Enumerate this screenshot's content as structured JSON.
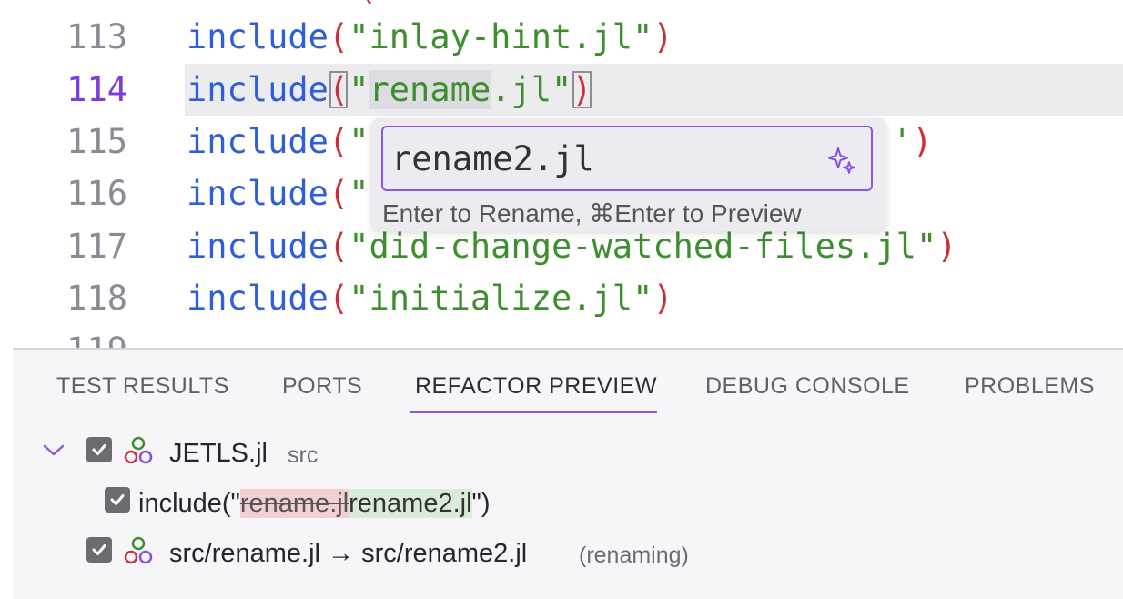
{
  "editor": {
    "lines": [
      {
        "num": "113",
        "kw": "include",
        "open": "(",
        "str": "\"inlay-hint.jl\"",
        "close": ")"
      },
      {
        "num": "114",
        "kw": "include",
        "open": "(",
        "q1": "\"",
        "sel": "rename",
        "rest": ".jl\"",
        "close": ")"
      },
      {
        "num": "115",
        "kw": "include",
        "open": "(",
        "frag": "\"",
        "tail": "')"
      },
      {
        "num": "116",
        "kw": "include",
        "open": "(",
        "frag": "\""
      },
      {
        "num": "117",
        "kw": "include",
        "open": "(",
        "str": "\"did-change-watched-files.jl\"",
        "close": ")"
      },
      {
        "num": "118",
        "kw": "include",
        "open": "(",
        "str": "\"initialize.jl\"",
        "close": ")"
      }
    ],
    "rename": {
      "value": "rename2.jl",
      "hint": "Enter to Rename, ⌘Enter to Preview"
    }
  },
  "panel": {
    "tabs": [
      "TEST RESULTS",
      "PORTS",
      "REFACTOR PREVIEW",
      "DEBUG CONSOLE",
      "PROBLEMS"
    ],
    "active_tab": "REFACTOR PREVIEW",
    "tree": {
      "root_label": "JETLS.jl",
      "root_sub": "src",
      "change_prefix": "include(\"",
      "change_old": "rename.jl",
      "change_new": "rename2.jl",
      "change_suffix": "\")",
      "file_rename": "src/rename.jl → src/rename2.jl",
      "file_rename_note": "(renaming)"
    }
  },
  "colors": {
    "accent": "#8a5be0",
    "keyword": "#2f5fd6",
    "string": "#3d8f2e",
    "paren": "#cc2f3a"
  },
  "icons": [
    "sparkle-icon",
    "chevron-down-icon",
    "checkbox-checked-icon",
    "refactor-nodes-icon"
  ]
}
